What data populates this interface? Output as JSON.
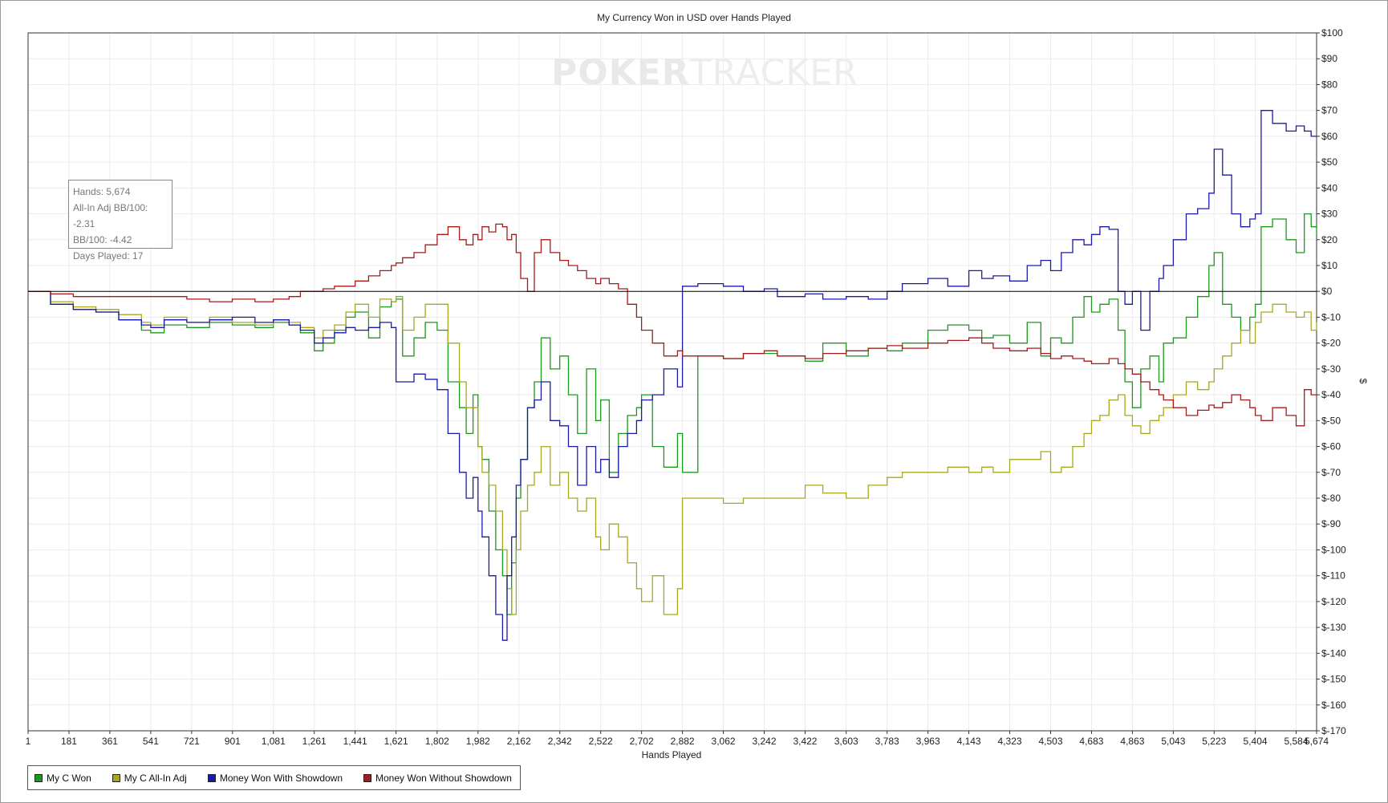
{
  "window": {
    "title": "My Currency Won in USD over Hands Played"
  },
  "watermark": {
    "part1": "POKER",
    "part2": "TRACKER"
  },
  "stats": {
    "hands": "Hands: 5,674",
    "allin_bb100": "All-In Adj BB/100: -2.31",
    "bb100": "BB/100: -4.42",
    "days": "Days Played: 17"
  },
  "chart_data": {
    "type": "line",
    "title": "My Currency Won in USD over Hands Played",
    "xlabel": "Hands Played",
    "ylabel": "$",
    "xlim": [
      1,
      5674
    ],
    "ylim": [
      -170,
      100
    ],
    "x_ticks": [
      1,
      181,
      361,
      541,
      721,
      901,
      1081,
      1261,
      1441,
      1621,
      1802,
      1982,
      2162,
      2342,
      2522,
      2702,
      2882,
      3062,
      3242,
      3422,
      3603,
      3783,
      3963,
      4143,
      4323,
      4503,
      4683,
      4863,
      5043,
      5223,
      5404,
      5584,
      5674
    ],
    "x_tick_labels": [
      "1",
      "181",
      "361",
      "541",
      "721",
      "901",
      "1,081",
      "1,261",
      "1,441",
      "1,621",
      "1,802",
      "1,982",
      "2,162",
      "2,342",
      "2,522",
      "2,702",
      "2,882",
      "3,062",
      "3,242",
      "3,422",
      "3,603",
      "3,783",
      "3,963",
      "4,143",
      "4,323",
      "4,503",
      "4,683",
      "4,863",
      "5,043",
      "5,223",
      "5,404",
      "5,584",
      "5,674"
    ],
    "y_ticks": [
      100,
      90,
      80,
      70,
      60,
      50,
      40,
      30,
      20,
      10,
      0,
      -10,
      -20,
      -30,
      -40,
      -50,
      -60,
      -70,
      -80,
      -90,
      -100,
      -110,
      -120,
      -130,
      -140,
      -150,
      -160,
      -170
    ],
    "y_tick_labels": [
      "$100",
      "$90",
      "$80",
      "$70",
      "$60",
      "$50",
      "$40",
      "$30",
      "$20",
      "$10",
      "$0",
      "$-10",
      "$-20",
      "$-30",
      "$-40",
      "$-50",
      "$-60",
      "$-70",
      "$-80",
      "$-90",
      "$-100",
      "$-110",
      "$-120",
      "$-130",
      "$-140",
      "$-150",
      "$-160",
      "$-170"
    ],
    "grid": true,
    "legend_position": "bottom-left",
    "series": [
      {
        "name": "My C Won",
        "color": "#1a9a1a",
        "x": [
          1,
          100,
          200,
          300,
          400,
          500,
          541,
          600,
          700,
          800,
          900,
          1000,
          1081,
          1150,
          1200,
          1261,
          1300,
          1350,
          1400,
          1441,
          1500,
          1550,
          1600,
          1621,
          1650,
          1700,
          1750,
          1802,
          1850,
          1900,
          1930,
          1960,
          1982,
          2000,
          2030,
          2060,
          2090,
          2110,
          2130,
          2150,
          2170,
          2200,
          2230,
          2260,
          2300,
          2342,
          2380,
          2420,
          2460,
          2500,
          2522,
          2560,
          2600,
          2640,
          2680,
          2702,
          2750,
          2800,
          2860,
          2882,
          2950,
          3062,
          3150,
          3242,
          3300,
          3422,
          3500,
          3603,
          3700,
          3783,
          3850,
          3963,
          4050,
          4143,
          4200,
          4250,
          4323,
          4400,
          4460,
          4503,
          4550,
          4600,
          4650,
          4683,
          4720,
          4760,
          4800,
          4830,
          4863,
          4900,
          4940,
          4980,
          5000,
          5043,
          5100,
          5150,
          5200,
          5223,
          5260,
          5300,
          5340,
          5380,
          5404,
          5430,
          5480,
          5540,
          5584,
          5620,
          5650,
          5674
        ],
        "y": [
          0,
          -5,
          -7,
          -8,
          -11,
          -15,
          -16,
          -13,
          -14,
          -12,
          -13,
          -14,
          -12,
          -13,
          -16,
          -23,
          -20,
          -15,
          -10,
          -8,
          -18,
          -6,
          -4,
          -3,
          -25,
          -18,
          -12,
          -15,
          -35,
          -45,
          -55,
          -40,
          -60,
          -65,
          -85,
          -100,
          -110,
          -125,
          -105,
          -80,
          -65,
          -45,
          -35,
          -18,
          -30,
          -25,
          -40,
          -55,
          -30,
          -50,
          -42,
          -70,
          -55,
          -48,
          -45,
          -40,
          -60,
          -68,
          -55,
          -70,
          -25,
          -26,
          -24,
          -24,
          -25,
          -27,
          -20,
          -25,
          -22,
          -23,
          -20,
          -15,
          -13,
          -15,
          -18,
          -17,
          -20,
          -12,
          -25,
          -18,
          -20,
          -10,
          -2,
          -8,
          -5,
          -3,
          -15,
          -35,
          -45,
          -30,
          -25,
          -35,
          -20,
          -18,
          -10,
          -2,
          10,
          15,
          -5,
          -10,
          -15,
          -10,
          -5,
          25,
          28,
          20,
          15,
          30,
          25,
          22
        ]
      },
      {
        "name": "My C All-In Adj",
        "color": "#a8a81a",
        "x": [
          1,
          100,
          200,
          300,
          400,
          500,
          541,
          600,
          700,
          800,
          900,
          1000,
          1081,
          1150,
          1200,
          1261,
          1300,
          1350,
          1400,
          1441,
          1500,
          1550,
          1600,
          1621,
          1650,
          1700,
          1750,
          1802,
          1850,
          1900,
          1930,
          1960,
          1982,
          2000,
          2030,
          2060,
          2090,
          2110,
          2130,
          2150,
          2170,
          2200,
          2230,
          2260,
          2300,
          2342,
          2380,
          2420,
          2460,
          2500,
          2522,
          2560,
          2600,
          2640,
          2680,
          2702,
          2750,
          2800,
          2860,
          2882,
          2950,
          3062,
          3150,
          3242,
          3300,
          3422,
          3500,
          3603,
          3700,
          3783,
          3850,
          3963,
          4050,
          4143,
          4200,
          4250,
          4323,
          4400,
          4460,
          4503,
          4550,
          4600,
          4650,
          4683,
          4720,
          4760,
          4800,
          4830,
          4863,
          4900,
          4940,
          4980,
          5000,
          5043,
          5100,
          5150,
          5200,
          5223,
          5260,
          5300,
          5340,
          5380,
          5404,
          5430,
          5480,
          5540,
          5584,
          5620,
          5650,
          5674
        ],
        "y": [
          0,
          -4,
          -6,
          -7,
          -9,
          -12,
          -13,
          -10,
          -12,
          -10,
          -12,
          -13,
          -11,
          -12,
          -14,
          -18,
          -15,
          -13,
          -8,
          -5,
          -10,
          -3,
          -4,
          -2,
          -15,
          -10,
          -5,
          -5,
          -20,
          -35,
          -45,
          -45,
          -60,
          -70,
          -75,
          -85,
          -100,
          -115,
          -125,
          -100,
          -85,
          -75,
          -70,
          -60,
          -75,
          -70,
          -80,
          -85,
          -80,
          -95,
          -100,
          -90,
          -95,
          -105,
          -115,
          -120,
          -110,
          -125,
          -115,
          -80,
          -80,
          -82,
          -80,
          -80,
          -80,
          -75,
          -78,
          -80,
          -75,
          -72,
          -70,
          -70,
          -68,
          -70,
          -68,
          -70,
          -65,
          -65,
          -62,
          -70,
          -68,
          -60,
          -55,
          -50,
          -48,
          -42,
          -40,
          -48,
          -52,
          -55,
          -50,
          -48,
          -45,
          -40,
          -35,
          -38,
          -35,
          -30,
          -25,
          -20,
          -15,
          -20,
          -12,
          -8,
          -5,
          -8,
          -10,
          -8,
          -15,
          -12
        ]
      },
      {
        "name": "Money Won With Showdown",
        "color": "#1a1aa8",
        "x": [
          1,
          100,
          200,
          300,
          400,
          500,
          541,
          600,
          700,
          800,
          900,
          1000,
          1081,
          1150,
          1200,
          1261,
          1300,
          1350,
          1400,
          1441,
          1500,
          1550,
          1600,
          1621,
          1650,
          1700,
          1750,
          1802,
          1850,
          1900,
          1930,
          1960,
          1982,
          2000,
          2030,
          2060,
          2090,
          2110,
          2130,
          2150,
          2170,
          2200,
          2230,
          2260,
          2300,
          2342,
          2380,
          2420,
          2460,
          2500,
          2522,
          2560,
          2600,
          2640,
          2680,
          2702,
          2750,
          2800,
          2860,
          2882,
          2950,
          3062,
          3150,
          3242,
          3300,
          3422,
          3500,
          3603,
          3700,
          3783,
          3850,
          3963,
          4050,
          4143,
          4200,
          4250,
          4323,
          4400,
          4460,
          4503,
          4550,
          4600,
          4650,
          4683,
          4720,
          4760,
          4800,
          4830,
          4863,
          4900,
          4940,
          4980,
          5000,
          5043,
          5100,
          5150,
          5200,
          5223,
          5260,
          5300,
          5340,
          5380,
          5404,
          5430,
          5480,
          5540,
          5584,
          5620,
          5650,
          5674
        ],
        "y": [
          0,
          -5,
          -7,
          -8,
          -11,
          -13,
          -14,
          -11,
          -12,
          -11,
          -10,
          -12,
          -11,
          -13,
          -15,
          -20,
          -18,
          -16,
          -14,
          -15,
          -14,
          -12,
          -14,
          -35,
          -35,
          -32,
          -34,
          -38,
          -55,
          -70,
          -80,
          -72,
          -85,
          -95,
          -110,
          -125,
          -135,
          -110,
          -95,
          -75,
          -65,
          -45,
          -42,
          -35,
          -50,
          -52,
          -60,
          -75,
          -60,
          -70,
          -65,
          -72,
          -60,
          -55,
          -50,
          -42,
          -40,
          -30,
          -37,
          2,
          3,
          2,
          0,
          1,
          -2,
          -1,
          -3,
          -2,
          -3,
          0,
          3,
          5,
          2,
          8,
          5,
          6,
          4,
          10,
          12,
          8,
          15,
          20,
          18,
          22,
          25,
          24,
          0,
          -5,
          0,
          -15,
          0,
          5,
          10,
          20,
          30,
          32,
          38,
          55,
          45,
          30,
          25,
          28,
          30,
          70,
          65,
          62,
          64,
          62,
          60,
          60
        ]
      },
      {
        "name": "Money Won Without Showdown",
        "color": "#a81a1a",
        "x": [
          1,
          100,
          200,
          300,
          400,
          500,
          541,
          600,
          700,
          800,
          900,
          1000,
          1081,
          1150,
          1200,
          1261,
          1300,
          1350,
          1400,
          1441,
          1500,
          1550,
          1600,
          1621,
          1650,
          1700,
          1750,
          1802,
          1850,
          1900,
          1930,
          1960,
          1982,
          2000,
          2030,
          2060,
          2090,
          2110,
          2130,
          2150,
          2170,
          2200,
          2230,
          2260,
          2300,
          2342,
          2380,
          2420,
          2460,
          2500,
          2522,
          2560,
          2600,
          2640,
          2680,
          2702,
          2750,
          2800,
          2860,
          2882,
          2950,
          3062,
          3150,
          3242,
          3300,
          3422,
          3500,
          3603,
          3700,
          3783,
          3850,
          3963,
          4050,
          4143,
          4200,
          4250,
          4323,
          4400,
          4460,
          4503,
          4550,
          4600,
          4650,
          4683,
          4720,
          4760,
          4800,
          4830,
          4863,
          4900,
          4940,
          4980,
          5000,
          5043,
          5100,
          5150,
          5200,
          5223,
          5260,
          5300,
          5340,
          5380,
          5404,
          5430,
          5480,
          5540,
          5584,
          5620,
          5650,
          5674
        ],
        "y": [
          0,
          -1,
          -2,
          -2,
          -2,
          -2,
          -2,
          -2,
          -3,
          -4,
          -3,
          -4,
          -3,
          -2,
          0,
          0,
          1,
          2,
          2,
          4,
          6,
          8,
          10,
          11,
          13,
          15,
          18,
          22,
          25,
          20,
          18,
          22,
          20,
          25,
          23,
          26,
          25,
          20,
          22,
          15,
          5,
          0,
          15,
          20,
          15,
          12,
          10,
          8,
          5,
          3,
          5,
          3,
          1,
          -5,
          -10,
          -15,
          -20,
          -25,
          -23,
          -25,
          -25,
          -26,
          -24,
          -23,
          -25,
          -26,
          -24,
          -23,
          -22,
          -21,
          -22,
          -20,
          -19,
          -18,
          -20,
          -22,
          -23,
          -22,
          -24,
          -26,
          -25,
          -26,
          -27,
          -28,
          -28,
          -26,
          -28,
          -30,
          -32,
          -35,
          -38,
          -40,
          -42,
          -45,
          -48,
          -46,
          -44,
          -45,
          -43,
          -40,
          -42,
          -45,
          -48,
          -50,
          -45,
          -48,
          -52,
          -38,
          -40,
          -40
        ]
      }
    ]
  }
}
